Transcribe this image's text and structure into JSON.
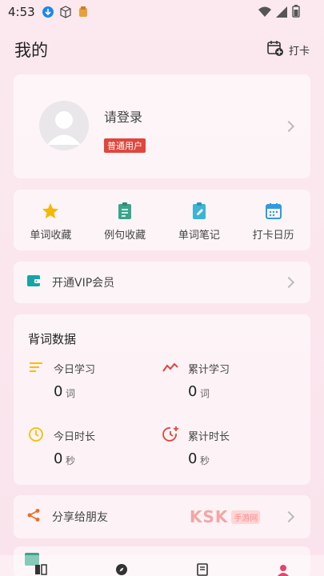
{
  "status_bar": {
    "time": "4:53"
  },
  "header": {
    "title": "我的",
    "checkin_label": "打卡"
  },
  "profile": {
    "login_text": "请登录",
    "badge": "普通用户"
  },
  "quick_actions": [
    {
      "label": "单词收藏",
      "icon": "star-icon",
      "color": "#f5b800"
    },
    {
      "label": "例句收藏",
      "icon": "clipboard-list-icon",
      "color": "#3aa58b"
    },
    {
      "label": "单词笔记",
      "icon": "clipboard-edit-icon",
      "color": "#3db3d6"
    },
    {
      "label": "打卡日历",
      "icon": "calendar-icon",
      "color": "#2f9be0"
    }
  ],
  "vip": {
    "label": "开通VIP会员",
    "color": "#19a3a8"
  },
  "stats": {
    "title": "背词数据",
    "items": [
      {
        "label": "今日学习",
        "value": "0",
        "unit": "词",
        "icon": "lines-icon",
        "color": "#f5c000"
      },
      {
        "label": "累计学习",
        "value": "0",
        "unit": "词",
        "icon": "trend-icon",
        "color": "#e0463c"
      },
      {
        "label": "今日时长",
        "value": "0",
        "unit": "秒",
        "icon": "clock-icon",
        "color": "#f5c000"
      },
      {
        "label": "累计时长",
        "value": "0",
        "unit": "秒",
        "icon": "clock-plus-icon",
        "color": "#e0463c"
      }
    ]
  },
  "share": {
    "label": "分享给朋友",
    "color": "#e8702a"
  },
  "watermark": {
    "text": "KSK",
    "sub": "手游网"
  }
}
